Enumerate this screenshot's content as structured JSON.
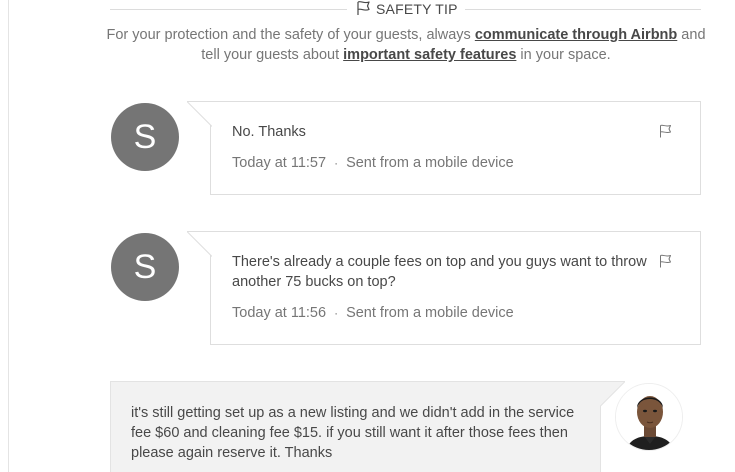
{
  "safety_tip": {
    "label": "SAFETY TIP",
    "text_1": "For your protection and the safety of your guests, always ",
    "link_1": "communicate through Airbnb",
    "text_2": " and tell your guests about ",
    "link_2": "important safety features",
    "text_3": " in your space."
  },
  "messages": [
    {
      "avatar_initial": "S",
      "text": "No. Thanks",
      "time": "Today at 11:57",
      "separator": "·",
      "source": "Sent from a mobile device"
    },
    {
      "avatar_initial": "S",
      "text": "There's already a couple fees on top and you guys want to throw another 75 bucks on top?",
      "time": "Today at 11:56",
      "separator": "·",
      "source": "Sent from a mobile device"
    }
  ],
  "outgoing_message": {
    "text": "it's still getting set up as a new listing and we didn't add in the service fee $60 and cleaning fee $15.  if you still want it after those fees then please again reserve it. Thanks"
  },
  "colors": {
    "avatar_bg": "#757575",
    "text": "#484848",
    "muted": "#767676",
    "outgoing_bg": "#f2f2f2"
  }
}
